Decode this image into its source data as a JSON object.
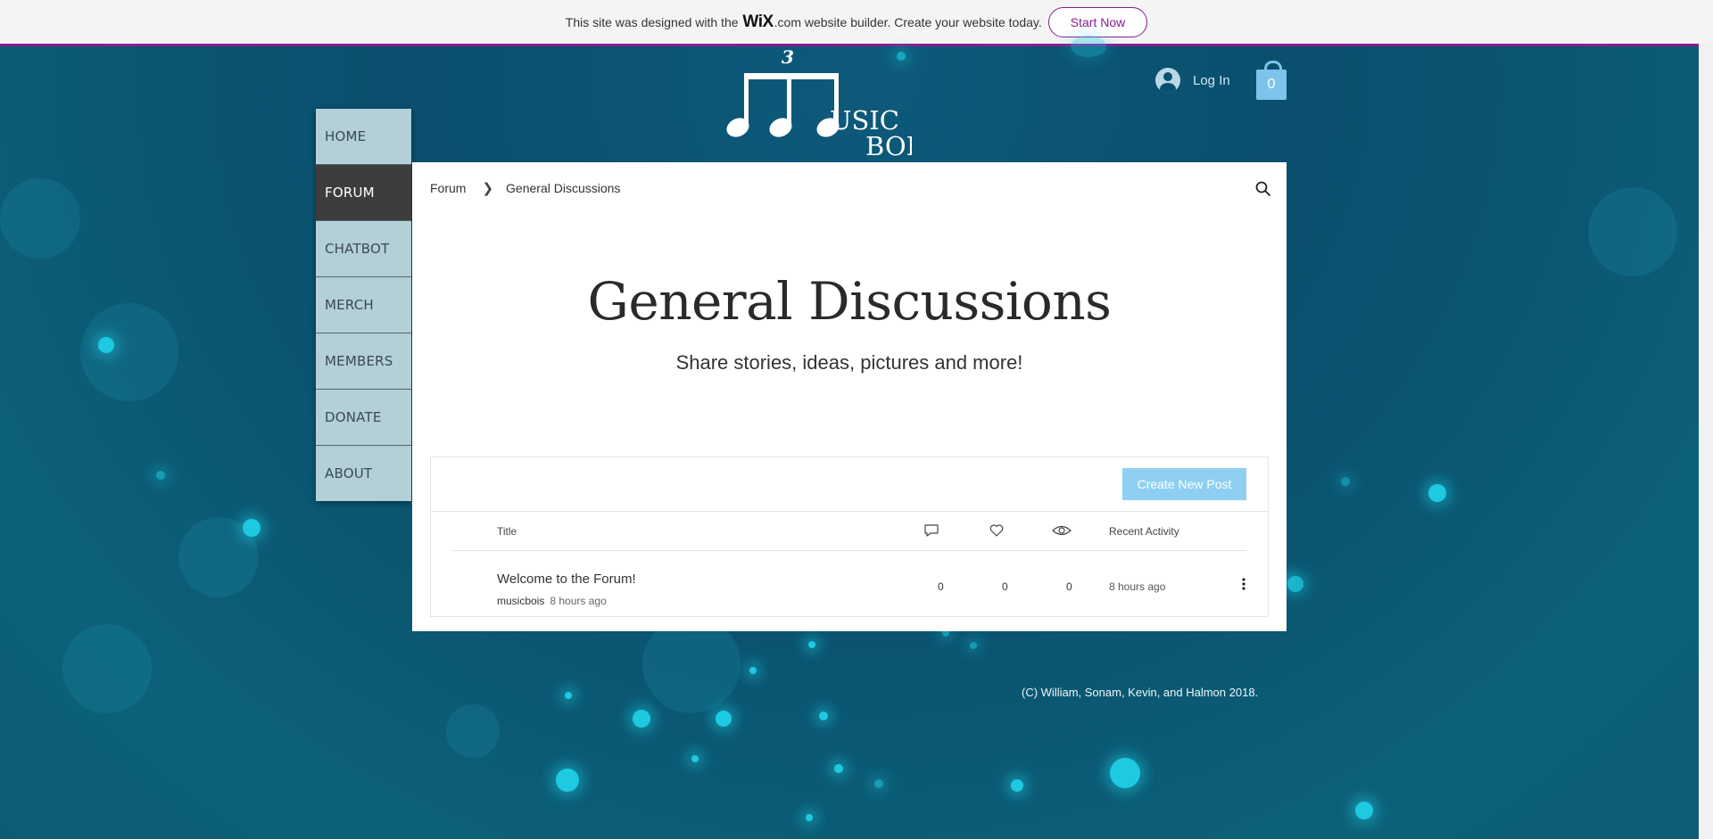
{
  "wix_banner": {
    "text_before": "This site was designed with the",
    "logo_text": "WiX",
    "logo_suffix": ".com",
    "text_after": "website builder. Create your website today.",
    "button_label": "Start Now"
  },
  "header": {
    "logo_text_line1": "USIC",
    "logo_text_line2": "BOI",
    "logo_tuplet": "3",
    "login_label": "Log In",
    "cart_count": "0"
  },
  "menu": {
    "items": [
      {
        "label": "HOME"
      },
      {
        "label": "FORUM"
      },
      {
        "label": "CHATBOT"
      },
      {
        "label": "MERCH"
      },
      {
        "label": "MEMBERS"
      },
      {
        "label": "DONATE"
      },
      {
        "label": "ABOUT"
      }
    ],
    "active": "FORUM"
  },
  "forum": {
    "breadcrumb": [
      "Forum",
      "General Discussions"
    ],
    "title": "General Discussions",
    "subtitle": "Share stories, ideas, pictures and more!",
    "create_button": "Create New Post",
    "columns": {
      "title": "Title",
      "recent_activity": "Recent Activity"
    },
    "posts": [
      {
        "title": "Welcome to the Forum!",
        "author": "musicbois",
        "time": "8 hours ago",
        "comments": "0",
        "likes": "0",
        "views": "0",
        "recent_activity": "8 hours ago"
      }
    ]
  },
  "footer": {
    "copyright": "(C) William, Sonam, Kevin, and Halmon 2018."
  },
  "colors": {
    "banner_accent": "#8a1c8f",
    "create_button": "#8fd0f2",
    "menu_bg": "#b3cfd8",
    "menu_active": "#3d3d3d"
  }
}
